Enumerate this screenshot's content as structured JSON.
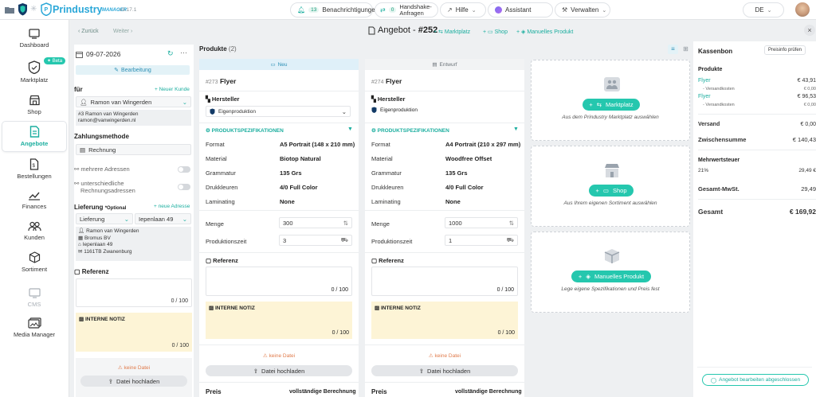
{
  "app": {
    "brand": "Prindustry",
    "suffix": "MANAGER",
    "version": "v3.17.1"
  },
  "topbar": {
    "notifications": {
      "count": "13",
      "label": "Benachrichtigungen"
    },
    "handshake": {
      "count": "0",
      "label_line1": "Handshake-",
      "label_line2": "Anfragen"
    },
    "help": "Hilfe",
    "assistant": "Assistant",
    "manage": "Verwalten",
    "language": "DE"
  },
  "sidebar": {
    "beta": "Beta",
    "items": [
      {
        "label": "Dashboard",
        "icon": "dashboard-icon"
      },
      {
        "label": "Marktplatz",
        "icon": "marketplace-icon"
      },
      {
        "label": "Shop",
        "icon": "shop-icon"
      },
      {
        "label": "Angebote",
        "icon": "quote-icon"
      },
      {
        "label": "Bestellungen",
        "icon": "orders-icon"
      },
      {
        "label": "Finances",
        "icon": "finances-icon"
      },
      {
        "label": "Kunden",
        "icon": "customers-icon"
      },
      {
        "label": "Sortiment",
        "icon": "assortment-icon"
      },
      {
        "label": "CMS",
        "icon": "cms-icon"
      },
      {
        "label": "Media Manager",
        "icon": "media-icon"
      }
    ]
  },
  "subheader": {
    "back": "Zurück",
    "next": "Weiter",
    "title_prefix": "Angebot - ",
    "number": "#252",
    "link_marketplace": "Marktplatz",
    "link_shop": "Shop",
    "link_manual": "Manuelles Produkt"
  },
  "left": {
    "date": "09-07-2026",
    "edit_button": "Bearbeitung",
    "for_label": "für",
    "new_customer": "+ Neuer Kunde",
    "customer": "Ramon van Wingerden",
    "customer_line1": "#3 Ramon van Wingerden",
    "customer_line2": "ramon@vanwingerden.nl",
    "payment_label": "Zahlungsmethode",
    "payment_value": "Rechnung",
    "multi_address": "mehrere Adressen",
    "diff_billing_1": "unterschiedliche",
    "diff_billing_2": "Rechnungsadressen",
    "delivery_label": "Lieferung",
    "optional": "*Optional",
    "new_address": "+ neue Adresse",
    "delivery_type": "Lieferung",
    "delivery_address": "Iepenlaan 49",
    "addr_name": "Ramon van Wingerden",
    "addr_company": "Bromus BV",
    "addr_street": "Iepenlaan 49",
    "addr_city": "1161TB Zwanenburg",
    "reference_label": "Referenz",
    "reference_count": "0 / 100",
    "note_label": "INTERNE NOTIZ",
    "note_count": "0 / 100",
    "no_file": "keine Datei",
    "upload": "Datei hochladen"
  },
  "products": {
    "title": "Produkte",
    "count": "(2)",
    "cards": [
      {
        "status": "Neu",
        "number": "#273",
        "name": "Flyer",
        "manufacturer_label": "Hersteller",
        "manufacturer": "Eigenproduktion",
        "spec_title": "PRODUKTSPEZIFIKATIONEN",
        "specs": [
          {
            "k": "Format",
            "v": "A5 Portrait (148 x 210 mm)"
          },
          {
            "k": "Material",
            "v": "Biotop Natural"
          },
          {
            "k": "Grammatur",
            "v": "135 Grs"
          },
          {
            "k": "Drukkleuren",
            "v": "4/0 Full Color"
          },
          {
            "k": "Laminating",
            "v": "None"
          }
        ],
        "qty_label": "Menge",
        "qty": "300",
        "time_label": "Produktionszeit",
        "time": "3",
        "reference_label": "Referenz",
        "reference_count": "0 / 100",
        "note_label": "INTERNE NOTIZ",
        "note_count": "0 / 100",
        "no_file": "keine Datei",
        "upload": "Datei hochladen",
        "price_label": "Preis",
        "price_value": "vollständige Berechnung"
      },
      {
        "status": "Entwurf",
        "number": "#274",
        "name": "Flyer",
        "manufacturer_label": "Hersteller",
        "manufacturer": "Eigenproduktion",
        "spec_title": "PRODUKTSPEZIFIKATIONEN",
        "specs": [
          {
            "k": "Format",
            "v": "A4 Portrait (210 x 297 mm)"
          },
          {
            "k": "Material",
            "v": "Woodfree Offset"
          },
          {
            "k": "Grammatur",
            "v": "135 Grs"
          },
          {
            "k": "Drukkleuren",
            "v": "4/0 Full Color"
          },
          {
            "k": "Laminating",
            "v": "None"
          }
        ],
        "qty_label": "Menge",
        "qty": "1000",
        "time_label": "Produktionszeit",
        "time": "1",
        "reference_label": "Referenz",
        "reference_count": "0 / 100",
        "note_label": "INTERNE NOTIZ",
        "note_count": "0 / 100",
        "no_file": "keine Datei",
        "upload": "Datei hochladen",
        "price_label": "Preis",
        "price_value": "vollständige Berechnung"
      }
    ],
    "add": [
      {
        "button": "Marktplatz",
        "hint": "Aus dem Prindustry Marktplatz auswählen",
        "icon": "handshake-icon"
      },
      {
        "button": "Shop",
        "hint": "Aus Ihrem eigenen Sortiment auswählen",
        "icon": "store-icon"
      },
      {
        "button": "Manuelles Produkt",
        "hint": "Lege eigene Spezifikationen und Preis fest",
        "icon": "box-icon"
      }
    ]
  },
  "receipt": {
    "title": "Kassenbon",
    "check_prices": "Preisinfo prüfen",
    "products_label": "Produkte",
    "lines": [
      {
        "name": "Flyer",
        "amount": "€ 43,91",
        "sub": "- Versandkosten",
        "sub_amount": "€ 0,00"
      },
      {
        "name": "Flyer",
        "amount": "€ 96,53",
        "sub": "- Versandkosten",
        "sub_amount": "€ 0,00"
      }
    ],
    "shipping_label": "Versand",
    "shipping_value": "€ 0,00",
    "subtotal_label": "Zwischensumme",
    "subtotal_value": "€ 140,43",
    "vat_label": "Mehrwertsteuer",
    "vat_rate": "21%",
    "vat_value": "29,49 €",
    "total_vat_label": "Gesamt-MwSt.",
    "total_vat_value": "29,49",
    "total_label": "Gesamt",
    "total_value": "€ 169,92",
    "finish_button": "Angebot bearbeiten abgeschlossen"
  },
  "colors": {
    "accent": "#25c7ae",
    "note": "#fdf4d6",
    "active": "#1bae9f"
  }
}
